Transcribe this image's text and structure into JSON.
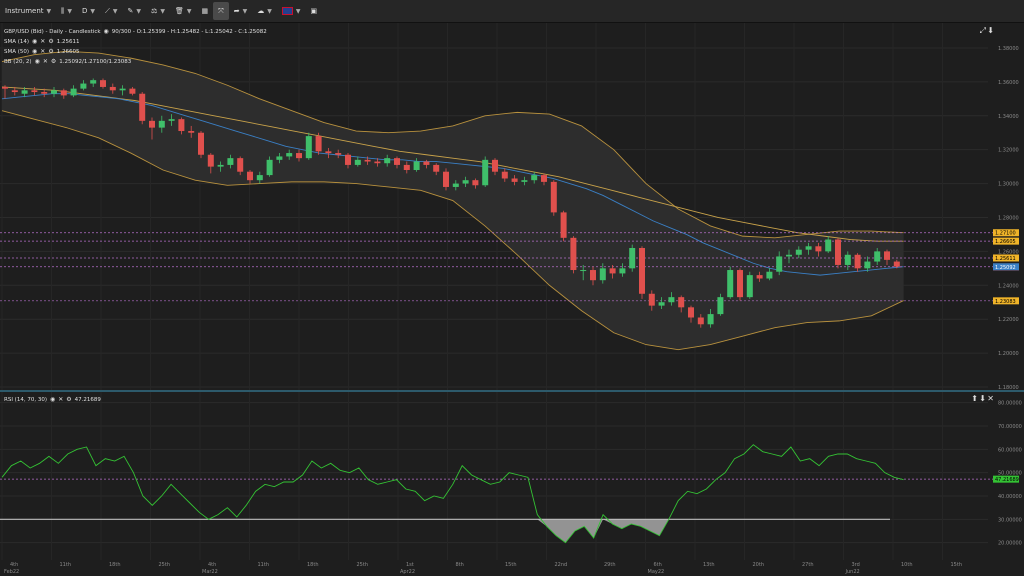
{
  "toolbar": {
    "instrument_label": "Instrument",
    "timeframe_label": "D",
    "icons": [
      "candles-icon",
      "line-tool-icon",
      "pen-icon",
      "indicators-icon",
      "trash-icon",
      "layout-icon",
      "fullscreen-icon",
      "share-icon",
      "weather-icon",
      "flag-uk-icon",
      "snapshot-icon"
    ]
  },
  "main_legend": {
    "title": "GBP/USD (Bid) - Daily - Candlestick",
    "ohlc": "90/300 - O:1.25399 - H:1.25482 - L:1.25042 - C:1.25082",
    "sma14_label": "SMA (14)",
    "sma14_value": "1.25611",
    "sma50_label": "SMA (50)",
    "sma50_value": "1.26605",
    "bb_label": "BB (20, 2)",
    "bb_value": "1.25092/1.27100/1.23083"
  },
  "rsi_legend": {
    "label": "RSI (14, 70, 30)",
    "value": "47.21689"
  },
  "colors": {
    "bull": "#3fbf6a",
    "bear": "#e0504d",
    "sma14": "#3a7fc4",
    "sma50": "#c8a24a",
    "bb": "#b8913e",
    "rsi": "#34c234",
    "level": "#b56fc9"
  },
  "chart_data": [
    {
      "type": "candlestick",
      "y_ticks": [
        "1.38000",
        "1.36000",
        "1.34000",
        "1.32000",
        "1.30000",
        "1.28000",
        "1.26000",
        "1.24000",
        "1.22000",
        "1.20000",
        "1.18000"
      ],
      "price_tags": [
        {
          "value": "1.27100",
          "color": "#f0b429",
          "text_color": "#000"
        },
        {
          "value": "1.26605",
          "color": "#f0b429",
          "text_color": "#000"
        },
        {
          "value": "1.25611",
          "color": "#f0b429",
          "text_color": "#000"
        },
        {
          "value": "1.25082",
          "color": "#e0504d",
          "text_color": "#fff"
        },
        {
          "value": "1.25092",
          "color": "#3a7fc4",
          "text_color": "#fff"
        },
        {
          "value": "1.23083",
          "color": "#f0b429",
          "text_color": "#000"
        }
      ],
      "levels": [
        1.271,
        1.26605,
        1.25611,
        1.25092,
        1.23083
      ],
      "ylim": [
        1.18,
        1.39
      ],
      "candles": [
        [
          1.357,
          1.356,
          1.358,
          1.35
        ],
        [
          1.355,
          1.354,
          1.357,
          1.352
        ],
        [
          1.353,
          1.355,
          1.357,
          1.351
        ],
        [
          1.355,
          1.354,
          1.357,
          1.352
        ],
        [
          1.354,
          1.353,
          1.356,
          1.351
        ],
        [
          1.353,
          1.355,
          1.357,
          1.351
        ],
        [
          1.355,
          1.352,
          1.356,
          1.35
        ],
        [
          1.352,
          1.356,
          1.358,
          1.351
        ],
        [
          1.356,
          1.359,
          1.361,
          1.355
        ],
        [
          1.359,
          1.361,
          1.362,
          1.357
        ],
        [
          1.361,
          1.357,
          1.362,
          1.356
        ],
        [
          1.357,
          1.355,
          1.359,
          1.353
        ],
        [
          1.355,
          1.356,
          1.358,
          1.352
        ],
        [
          1.356,
          1.353,
          1.357,
          1.352
        ],
        [
          1.353,
          1.337,
          1.354,
          1.335
        ],
        [
          1.337,
          1.333,
          1.339,
          1.326
        ],
        [
          1.333,
          1.337,
          1.34,
          1.33
        ],
        [
          1.337,
          1.338,
          1.341,
          1.334
        ],
        [
          1.338,
          1.331,
          1.339,
          1.329
        ],
        [
          1.331,
          1.33,
          1.334,
          1.327
        ],
        [
          1.33,
          1.317,
          1.331,
          1.315
        ],
        [
          1.317,
          1.31,
          1.318,
          1.306
        ],
        [
          1.31,
          1.311,
          1.313,
          1.307
        ],
        [
          1.311,
          1.315,
          1.317,
          1.309
        ],
        [
          1.315,
          1.307,
          1.316,
          1.305
        ],
        [
          1.307,
          1.302,
          1.308,
          1.3
        ],
        [
          1.302,
          1.305,
          1.307,
          1.3
        ],
        [
          1.305,
          1.314,
          1.316,
          1.304
        ],
        [
          1.314,
          1.316,
          1.318,
          1.312
        ],
        [
          1.316,
          1.318,
          1.32,
          1.314
        ],
        [
          1.318,
          1.315,
          1.32,
          1.313
        ],
        [
          1.315,
          1.328,
          1.33,
          1.314
        ],
        [
          1.328,
          1.319,
          1.33,
          1.317
        ],
        [
          1.319,
          1.318,
          1.321,
          1.315
        ],
        [
          1.318,
          1.317,
          1.32,
          1.315
        ],
        [
          1.317,
          1.311,
          1.318,
          1.309
        ],
        [
          1.311,
          1.314,
          1.316,
          1.31
        ],
        [
          1.314,
          1.313,
          1.316,
          1.311
        ],
        [
          1.313,
          1.312,
          1.315,
          1.31
        ],
        [
          1.312,
          1.315,
          1.317,
          1.31
        ],
        [
          1.315,
          1.311,
          1.316,
          1.309
        ],
        [
          1.311,
          1.308,
          1.313,
          1.306
        ],
        [
          1.308,
          1.313,
          1.315,
          1.307
        ],
        [
          1.313,
          1.311,
          1.314,
          1.309
        ],
        [
          1.311,
          1.307,
          1.312,
          1.305
        ],
        [
          1.307,
          1.298,
          1.309,
          1.296
        ],
        [
          1.298,
          1.3,
          1.302,
          1.296
        ],
        [
          1.3,
          1.302,
          1.304,
          1.298
        ],
        [
          1.302,
          1.299,
          1.303,
          1.297
        ],
        [
          1.299,
          1.314,
          1.316,
          1.298
        ],
        [
          1.314,
          1.307,
          1.315,
          1.305
        ],
        [
          1.307,
          1.303,
          1.309,
          1.301
        ],
        [
          1.303,
          1.301,
          1.305,
          1.299
        ],
        [
          1.301,
          1.302,
          1.304,
          1.299
        ],
        [
          1.302,
          1.305,
          1.307,
          1.3
        ],
        [
          1.305,
          1.301,
          1.306,
          1.299
        ],
        [
          1.301,
          1.283,
          1.302,
          1.281
        ],
        [
          1.283,
          1.268,
          1.284,
          1.266
        ],
        [
          1.268,
          1.249,
          1.269,
          1.247
        ],
        [
          1.249,
          1.249,
          1.252,
          1.243
        ],
        [
          1.249,
          1.243,
          1.251,
          1.24
        ],
        [
          1.243,
          1.25,
          1.253,
          1.241
        ],
        [
          1.25,
          1.247,
          1.252,
          1.244
        ],
        [
          1.247,
          1.25,
          1.253,
          1.245
        ],
        [
          1.25,
          1.262,
          1.264,
          1.248
        ],
        [
          1.262,
          1.235,
          1.263,
          1.232
        ],
        [
          1.235,
          1.228,
          1.237,
          1.225
        ],
        [
          1.228,
          1.23,
          1.233,
          1.226
        ],
        [
          1.23,
          1.233,
          1.236,
          1.228
        ],
        [
          1.233,
          1.227,
          1.234,
          1.224
        ],
        [
          1.227,
          1.221,
          1.228,
          1.218
        ],
        [
          1.221,
          1.217,
          1.223,
          1.215
        ],
        [
          1.217,
          1.223,
          1.226,
          1.215
        ],
        [
          1.223,
          1.233,
          1.235,
          1.222
        ],
        [
          1.233,
          1.249,
          1.251,
          1.232
        ],
        [
          1.249,
          1.233,
          1.25,
          1.231
        ],
        [
          1.233,
          1.246,
          1.248,
          1.232
        ],
        [
          1.246,
          1.244,
          1.248,
          1.242
        ],
        [
          1.244,
          1.248,
          1.25,
          1.243
        ],
        [
          1.248,
          1.257,
          1.26,
          1.246
        ],
        [
          1.257,
          1.258,
          1.261,
          1.253
        ],
        [
          1.258,
          1.261,
          1.263,
          1.256
        ],
        [
          1.261,
          1.263,
          1.265,
          1.258
        ],
        [
          1.263,
          1.26,
          1.265,
          1.257
        ],
        [
          1.26,
          1.267,
          1.269,
          1.259
        ],
        [
          1.267,
          1.252,
          1.268,
          1.25
        ],
        [
          1.252,
          1.258,
          1.26,
          1.249
        ],
        [
          1.258,
          1.25,
          1.259,
          1.248
        ],
        [
          1.25,
          1.254,
          1.257,
          1.248
        ],
        [
          1.254,
          1.26,
          1.262,
          1.252
        ],
        [
          1.26,
          1.255,
          1.261,
          1.252
        ],
        [
          1.254,
          1.251,
          1.255,
          1.25
        ]
      ],
      "sma14": [
        1.35,
        1.351,
        1.352,
        1.353,
        1.353,
        1.352,
        1.351,
        1.35,
        1.348,
        1.346,
        1.343,
        1.34,
        1.337,
        1.334,
        1.331,
        1.328,
        1.325,
        1.322,
        1.32,
        1.318,
        1.317,
        1.316,
        1.315,
        1.314,
        1.314,
        1.313,
        1.313,
        1.312,
        1.311,
        1.31,
        1.309,
        1.307,
        1.305,
        1.303,
        1.3,
        1.297,
        1.293,
        1.288,
        1.283,
        1.278,
        1.274,
        1.27,
        1.265,
        1.261,
        1.257,
        1.253,
        1.25,
        1.248,
        1.247,
        1.246,
        1.247,
        1.248,
        1.249,
        1.25,
        1.251
      ],
      "sma50": [
        1.357,
        1.356,
        1.355,
        1.353,
        1.351,
        1.349,
        1.346,
        1.343,
        1.34,
        1.337,
        1.334,
        1.331,
        1.328,
        1.325,
        1.322,
        1.319,
        1.317,
        1.315,
        1.313,
        1.31,
        1.307,
        1.304,
        1.3,
        1.296,
        1.292,
        1.288,
        1.284,
        1.28,
        1.277,
        1.274,
        1.271,
        1.269,
        1.267,
        1.266,
        1.266
      ],
      "bb_upper": [
        1.372,
        1.376,
        1.378,
        1.377,
        1.374,
        1.37,
        1.365,
        1.358,
        1.35,
        1.343,
        1.336,
        1.331,
        1.33,
        1.331,
        1.334,
        1.34,
        1.342,
        1.341,
        1.334,
        1.32,
        1.3,
        1.285,
        1.275,
        1.269,
        1.268,
        1.27,
        1.272,
        1.272,
        1.271
      ],
      "bb_lower": [
        1.343,
        1.338,
        1.333,
        1.327,
        1.318,
        1.308,
        1.302,
        1.299,
        1.3,
        1.301,
        1.301,
        1.3,
        1.298,
        1.296,
        1.29,
        1.275,
        1.258,
        1.24,
        1.225,
        1.212,
        1.205,
        1.202,
        1.205,
        1.21,
        1.215,
        1.218,
        1.219,
        1.222,
        1.231
      ],
      "x_ticks": [
        "4th",
        "11th",
        "18th",
        "25th",
        "4th",
        "11th",
        "18th",
        "25th",
        "1st",
        "8th",
        "15th",
        "22nd",
        "29th",
        "6th",
        "13th",
        "20th",
        "27th",
        "3rd",
        "10th",
        "15th"
      ],
      "x_month_labels": [
        {
          "at": 0,
          "text": "Feb22"
        },
        {
          "at": 4,
          "text": "Mar22"
        },
        {
          "at": 8,
          "text": "Apr22"
        },
        {
          "at": 13,
          "text": "May22"
        },
        {
          "at": 17,
          "text": "Jun22"
        }
      ]
    },
    {
      "type": "line",
      "name": "RSI (14, 70, 30)",
      "y_ticks": [
        "80.00000",
        "70.00000",
        "60.00000",
        "50.00000",
        "40.00000",
        "30.00000",
        "20.00000"
      ],
      "ylim": [
        16,
        82
      ],
      "oversold": 30,
      "values": [
        48,
        53,
        55,
        52,
        54,
        57,
        54,
        58,
        60,
        61,
        53,
        56,
        55,
        57,
        50,
        40,
        36,
        40,
        45,
        41,
        37,
        33,
        30,
        32,
        35,
        31,
        36,
        42,
        45,
        44,
        46,
        46,
        49,
        55,
        52,
        54,
        51,
        50,
        52,
        47,
        45,
        46,
        47,
        43,
        42,
        38,
        40,
        39,
        45,
        53,
        49,
        47,
        45,
        46,
        50,
        49,
        48,
        32,
        27,
        23,
        20,
        25,
        27,
        22,
        32,
        28,
        26,
        28,
        27,
        25,
        23,
        30,
        38,
        42,
        41,
        43,
        47,
        50,
        56,
        58,
        62,
        59,
        58,
        57,
        61,
        55,
        56,
        53,
        57,
        58,
        58,
        56,
        55,
        54,
        50,
        48,
        47
      ]
    }
  ]
}
